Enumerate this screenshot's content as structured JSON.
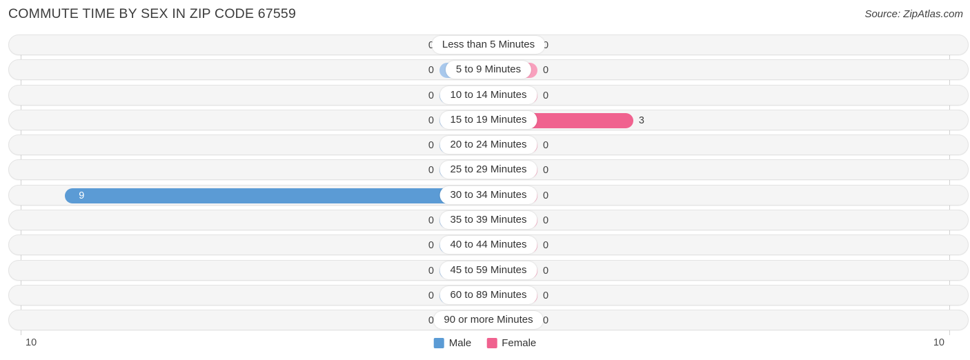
{
  "header": {
    "title": "COMMUTE TIME BY SEX IN ZIP CODE 67559",
    "source": "Source: ZipAtlas.com"
  },
  "axis": {
    "left_tick": "10",
    "right_tick": "10"
  },
  "legend": {
    "items": [
      {
        "label": "Male",
        "color": "#5b9bd5",
        "icon": "male-swatch-icon"
      },
      {
        "label": "Female",
        "color": "#f0628f",
        "icon": "female-swatch-icon"
      }
    ]
  },
  "colors": {
    "male_zero": "#a8c8ec",
    "male_value": "#5b9bd5",
    "female_zero": "#f8a0bd",
    "female_value": "#f0628f",
    "row_background": "#f5f5f5",
    "row_border": "#e3e3e3",
    "axis_line": "#d2d2d2"
  },
  "chart_data": {
    "type": "bar",
    "title": "COMMUTE TIME BY SEX IN ZIP CODE 67559",
    "subtitle": "Source: ZipAtlas.com",
    "orientation": "horizontal-diverging",
    "xlabel": "",
    "ylabel": "",
    "xlim": [
      10,
      10
    ],
    "grid": false,
    "legend_position": "bottom-center",
    "categories": [
      "Less than 5 Minutes",
      "5 to 9 Minutes",
      "10 to 14 Minutes",
      "15 to 19 Minutes",
      "20 to 24 Minutes",
      "25 to 29 Minutes",
      "30 to 34 Minutes",
      "35 to 39 Minutes",
      "40 to 44 Minutes",
      "45 to 59 Minutes",
      "60 to 89 Minutes",
      "90 or more Minutes"
    ],
    "series": [
      {
        "name": "Male",
        "values": [
          0,
          0,
          0,
          0,
          0,
          0,
          9,
          0,
          0,
          0,
          0,
          0
        ]
      },
      {
        "name": "Female",
        "values": [
          0,
          0,
          0,
          3,
          0,
          0,
          0,
          0,
          0,
          0,
          0,
          0
        ]
      }
    ]
  },
  "rows": [
    {
      "label": "Less than 5 Minutes",
      "male": "0",
      "female": "0"
    },
    {
      "label": "5 to 9 Minutes",
      "male": "0",
      "female": "0"
    },
    {
      "label": "10 to 14 Minutes",
      "male": "0",
      "female": "0"
    },
    {
      "label": "15 to 19 Minutes",
      "male": "0",
      "female": "3"
    },
    {
      "label": "20 to 24 Minutes",
      "male": "0",
      "female": "0"
    },
    {
      "label": "25 to 29 Minutes",
      "male": "0",
      "female": "0"
    },
    {
      "label": "30 to 34 Minutes",
      "male": "9",
      "female": "0"
    },
    {
      "label": "35 to 39 Minutes",
      "male": "0",
      "female": "0"
    },
    {
      "label": "40 to 44 Minutes",
      "male": "0",
      "female": "0"
    },
    {
      "label": "45 to 59 Minutes",
      "male": "0",
      "female": "0"
    },
    {
      "label": "60 to 89 Minutes",
      "male": "0",
      "female": "0"
    },
    {
      "label": "90 or more Minutes",
      "male": "0",
      "female": "0"
    }
  ]
}
